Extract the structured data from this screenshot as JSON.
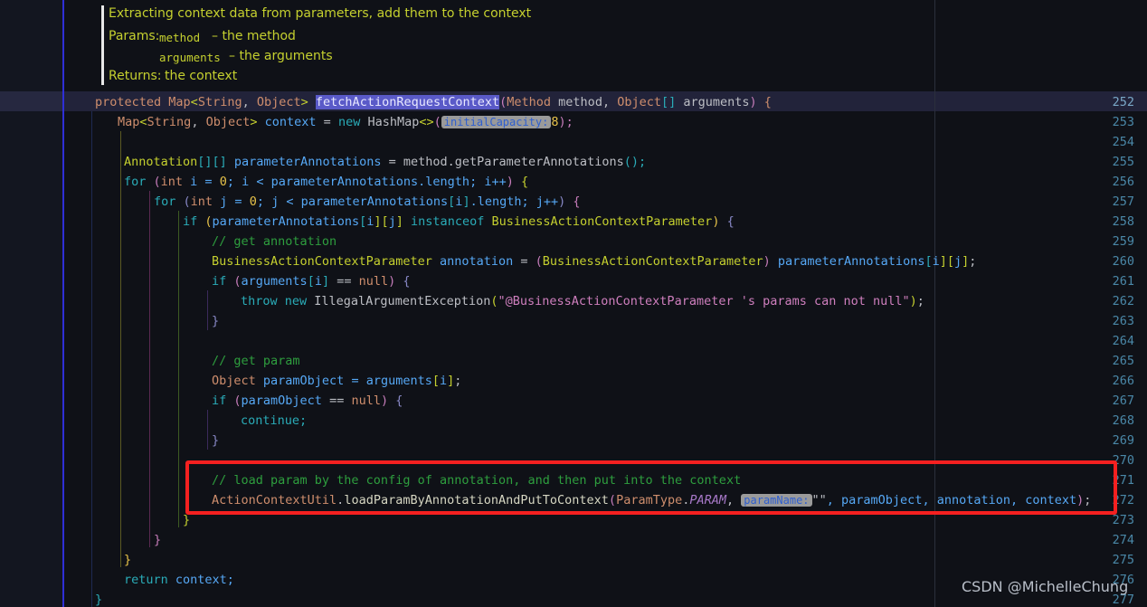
{
  "editor": {
    "background": "#0f1117",
    "gutter_background": "#131620",
    "caret_line_background": "#22233a",
    "accent_red": "#f52020",
    "line_number_color": "#4a88a8"
  },
  "doc_comment": {
    "summary": "Extracting context data from parameters, add them to the context",
    "params_label": "Params:",
    "param1_name": "method",
    "param1_desc": "– the method",
    "param2_name": "arguments",
    "param2_desc": "– the arguments",
    "returns_label": "Returns:",
    "returns_desc": "the context"
  },
  "line_numbers": [
    "252",
    "253",
    "254",
    "255",
    "256",
    "257",
    "258",
    "259",
    "260",
    "261",
    "262",
    "263",
    "264",
    "265",
    "266",
    "267",
    "268",
    "269",
    "270",
    "271",
    "272",
    "273",
    "274",
    "275",
    "276",
    "277"
  ],
  "current_line": "252",
  "inlay_hints": {
    "initial_capacity": "initialCapacity:",
    "param_name": "paramName:"
  },
  "selected_symbol": "fetchActionRequestContext",
  "code_lines": {
    "l252_a": "protected ",
    "l252_b": "Map",
    "l252_c": "<",
    "l252_d": "String",
    "l252_e": ", ",
    "l252_f": "Object",
    "l252_g": ">",
    "l252_h": " ",
    "l252_sel": "fetchActionRequestContext",
    "l252_i": "(",
    "l252_j": "Method",
    "l252_k": " method, ",
    "l252_l": "Object",
    "l252_m": "[]",
    "l252_n": " arguments",
    "l252_o": ")",
    "l252_p": " {",
    "l253_a": "Map",
    "l253_b": "<",
    "l253_c": "String",
    "l253_d": ", ",
    "l253_e": "Object",
    "l253_f": ">",
    "l253_g": " ",
    "l253_h": "context",
    "l253_i": " = ",
    "l253_j": "new",
    "l253_k": " HashMap",
    "l253_l": "<>",
    "l253_m": "(",
    "l253_n": "8",
    "l253_o": ");",
    "l255_a": "Annotation",
    "l255_b": "[][]",
    "l255_c": " parameterAnnotations",
    "l255_d": " = method.",
    "l255_e": "getParameterAnnotations",
    "l255_f": "();",
    "l256_a": "for",
    "l256_b": " (",
    "l256_c": "int",
    "l256_d": " i = ",
    "l256_e": "0",
    "l256_f": "; i < parameterAnnotations.",
    "l256_g": "length",
    "l256_h": "; i++",
    "l256_i": ")",
    "l256_j": " {",
    "l257_a": "for",
    "l257_b": " (",
    "l257_c": "int",
    "l257_d": " j = ",
    "l257_e": "0",
    "l257_f": "; j < parameterAnnotations",
    "l257_g": "[",
    "l257_h": "i",
    "l257_i": "]",
    "l257_j": ".length; j++",
    "l257_k": ")",
    "l257_l": " {",
    "l258_a": "if",
    "l258_b": " (",
    "l258_c": "parameterAnnotations",
    "l258_d": "[",
    "l258_e": "i",
    "l258_f": "][",
    "l258_g": "j",
    "l258_h": "]",
    "l258_i": " instanceof ",
    "l258_j": "BusinessActionContextParameter",
    "l258_k": ")",
    "l258_l": " {",
    "l259": "// get annotation",
    "l260_a": "BusinessActionContextParameter",
    "l260_b": " annotation",
    "l260_c": " = ",
    "l260_d": "(",
    "l260_e": "BusinessActionContextParameter",
    "l260_f": ")",
    "l260_g": " parameterAnnotations",
    "l260_h": "[",
    "l260_i": "i",
    "l260_j": "][",
    "l260_k": "j",
    "l260_l": "]",
    "l260_m": ";",
    "l261_a": "if",
    "l261_b": " (",
    "l261_c": "arguments",
    "l261_d": "[",
    "l261_e": "i",
    "l261_f": "]",
    "l261_g": " == ",
    "l261_h": "null",
    "l261_i": ")",
    "l261_j": " {",
    "l262_a": "throw",
    "l262_b": " new",
    "l262_c": " IllegalArgumentException",
    "l262_d": "(",
    "l262_e": "\"@BusinessActionContextParameter 's params can not null\"",
    "l262_f": ")",
    "l262_g": ";",
    "l263": "}",
    "l265": "// get param",
    "l266_a": "Object",
    "l266_b": " paramObject",
    "l266_c": " = arguments",
    "l266_d": "[",
    "l266_e": "i",
    "l266_f": "]",
    "l266_g": ";",
    "l267_a": "if",
    "l267_b": " (",
    "l267_c": "paramObject",
    "l267_d": " == ",
    "l267_e": "null",
    "l267_f": ")",
    "l267_g": " {",
    "l268": "continue;",
    "l269": "}",
    "l271": "// load param by the config of annotation, and then put into the context",
    "l272_a": "ActionContextUtil",
    "l272_b": ".",
    "l272_c": "loadParamByAnnotationAndPutToContext",
    "l272_d": "(",
    "l272_e": "ParamType",
    "l272_f": ".",
    "l272_g": "PARAM",
    "l272_h": ", ",
    "l272_i": "\"\"",
    "l272_j": ", paramObject",
    "l272_k": ", annotation",
    "l272_l": ", context",
    "l272_m": ")",
    "l272_n": ";",
    "l273": "}",
    "l274": "}",
    "l275": "}",
    "l276_a": "return",
    "l276_b": " context;",
    "l277": "}"
  },
  "watermark": "CSDN @MichelleChung"
}
